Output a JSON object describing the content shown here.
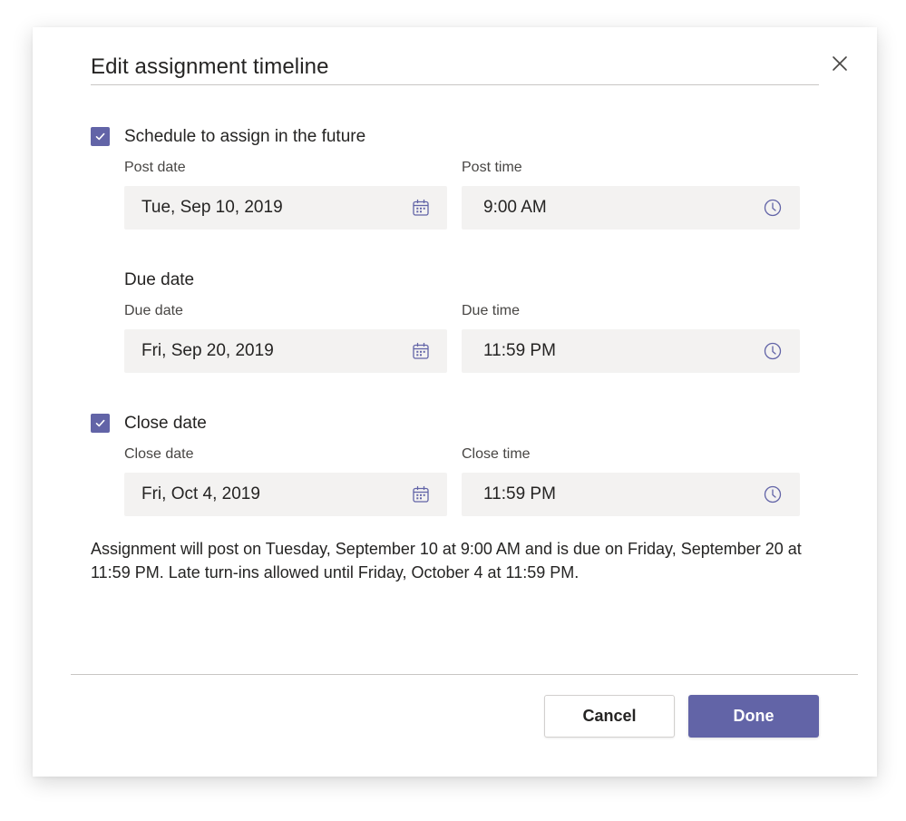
{
  "dialog": {
    "title": "Edit assignment timeline",
    "close_icon": "close-icon"
  },
  "colors": {
    "accent": "#6264a7",
    "input_bg": "#f3f2f1"
  },
  "schedule": {
    "checked": true,
    "label": "Schedule to assign in the future",
    "post_date_label": "Post date",
    "post_date_value": "Tue, Sep 10, 2019",
    "post_time_label": "Post time",
    "post_time_value": "9:00 AM"
  },
  "due": {
    "heading": "Due date",
    "due_date_label": "Due date",
    "due_date_value": "Fri, Sep 20, 2019",
    "due_time_label": "Due time",
    "due_time_value": "11:59 PM"
  },
  "close": {
    "checked": true,
    "label": "Close date",
    "close_date_label": "Close date",
    "close_date_value": "Fri, Oct 4, 2019",
    "close_time_label": "Close time",
    "close_time_value": "11:59 PM"
  },
  "summary": "Assignment will post on Tuesday, September 10 at 9:00 AM and is due on Friday, September 20 at 11:59 PM. Late turn-ins allowed until Friday, October 4 at 11:59 PM.",
  "footer": {
    "cancel_label": "Cancel",
    "done_label": "Done"
  },
  "icons": {
    "date_picker": "calendar-icon",
    "time_picker": "clock-icon",
    "checkbox": "checkmark-icon"
  }
}
